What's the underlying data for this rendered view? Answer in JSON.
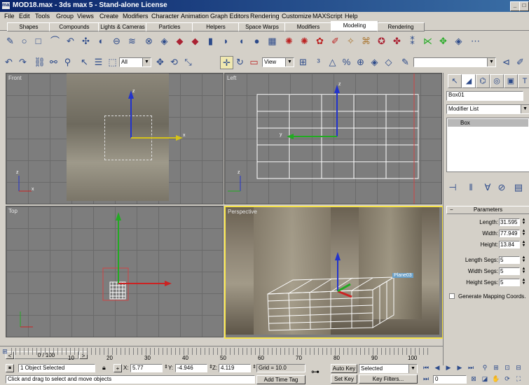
{
  "window": {
    "title": "MOD18.max - 3ds max 5 - Stand-alone License",
    "app_icon": "max"
  },
  "menu": [
    "File",
    "Edit",
    "Tools",
    "Group",
    "Views",
    "Create",
    "Modifiers",
    "Character",
    "Animation",
    "Graph Editors",
    "Rendering",
    "Customize",
    "MAXScript",
    "Help"
  ],
  "tabs": [
    "Shapes",
    "Compounds",
    "Lights & Cameras",
    "Particles",
    "Helpers",
    "Space Warps",
    "Modifiers",
    "Modeling",
    "Rendering"
  ],
  "active_tab": "Modeling",
  "toolbar": {
    "selection_filter": "All",
    "ref_coord": "View"
  },
  "viewports": {
    "front": {
      "label": "Front"
    },
    "left": {
      "label": "Left"
    },
    "top": {
      "label": "Top"
    },
    "perspective": {
      "label": "Perspective",
      "object_tag": "Plane03"
    }
  },
  "axis_labels": {
    "x": "x",
    "y": "y",
    "z": "z"
  },
  "command_panel": {
    "object_name": "Box01",
    "modifier_list": "Modifier List",
    "stack_item": "Box",
    "rollout_title": "Parameters",
    "params": [
      {
        "label": "Length:",
        "value": "31.595"
      },
      {
        "label": "Width:",
        "value": "77.949"
      },
      {
        "label": "Height:",
        "value": "13.84"
      },
      {
        "label": "Length Segs:",
        "value": "5"
      },
      {
        "label": "Width Segs:",
        "value": "5"
      },
      {
        "label": "Height Segs:",
        "value": "5"
      }
    ],
    "checkbox_label": "Generate Mapping Coords."
  },
  "timeline": {
    "frame_display": "0 / 100",
    "ticks": [
      "10",
      "20",
      "30",
      "40",
      "50",
      "60",
      "70",
      "80",
      "90",
      "100"
    ]
  },
  "status": {
    "selected": "1 Object Selected",
    "prompt": "Click and drag to select and move objects",
    "x_label": "X:",
    "x": "5.77",
    "y_label": "Y:",
    "y": "-4.946",
    "z_label": "Z:",
    "z": "4.119",
    "grid": "Grid = 10.0",
    "add_time_tag": "Add Time Tag",
    "auto_key": "Auto Key",
    "key_mode": "Selected",
    "set_key": "Set Key",
    "key_filters": "Key Filters...",
    "frame": "0"
  }
}
